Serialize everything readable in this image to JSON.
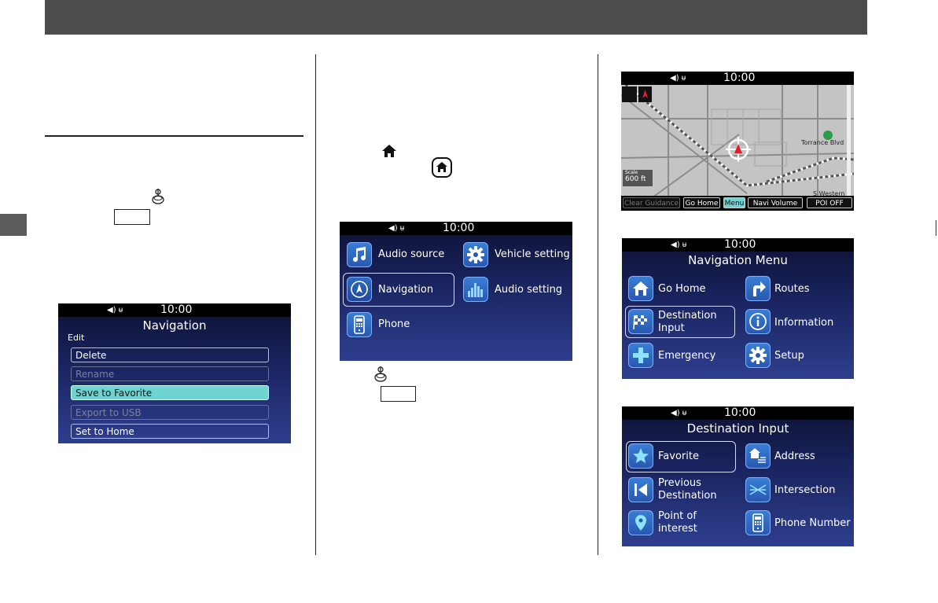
{
  "colors": {
    "header": "#4d4d4d",
    "highlight": "#6fd3d1",
    "screen_top": "#0d1233",
    "screen_bottom": "#2e3f8e"
  },
  "status": {
    "time": "10:00"
  },
  "nav_edit_screen": {
    "title": "Navigation",
    "subtitle": "Edit",
    "items": [
      {
        "label": "Delete",
        "state": "normal"
      },
      {
        "label": "Rename",
        "state": "disabled"
      },
      {
        "label": "Save to Favorite",
        "state": "highlighted"
      },
      {
        "label": "Export to USB",
        "state": "disabled"
      },
      {
        "label": "Set to Home",
        "state": "normal"
      }
    ]
  },
  "home_screen": {
    "items": [
      {
        "label": "Audio source",
        "icon": "music-note-icon"
      },
      {
        "label": "Vehicle setting",
        "icon": "gear-icon"
      },
      {
        "label": "Navigation",
        "icon": "compass-icon"
      },
      {
        "label": "Audio setting",
        "icon": "equalizer-icon"
      },
      {
        "label": "Phone",
        "icon": "phone-icon"
      }
    ]
  },
  "map_screen": {
    "street_label": "Torrance Blvd",
    "street_label2": "S Western Ave",
    "scale_label": "Scale",
    "scale_value": "600 ft",
    "buttons": [
      "Clear Guidance",
      "Go Home",
      "Menu",
      "Navi Volume",
      "POI OFF"
    ]
  },
  "nav_menu_screen": {
    "title": "Navigation Menu",
    "items": [
      {
        "label": "Go Home",
        "icon": "home-icon"
      },
      {
        "label": "Routes",
        "icon": "route-arrow-icon"
      },
      {
        "label": "Destination\nInput",
        "line1": "Destination",
        "line2": "Input",
        "icon": "checkered-flag-icon"
      },
      {
        "label": "Information",
        "icon": "info-icon"
      },
      {
        "label": "Emergency",
        "icon": "cross-icon"
      },
      {
        "label": "Setup",
        "icon": "gear-icon"
      }
    ]
  },
  "dest_input_screen": {
    "title": "Destination Input",
    "items": [
      {
        "line1": "Favorite",
        "icon": "star-icon"
      },
      {
        "line1": "Address",
        "icon": "address-icon"
      },
      {
        "line1": "Previous",
        "line2": "Destination",
        "icon": "previous-icon"
      },
      {
        "line1": "Intersection",
        "icon": "intersection-icon"
      },
      {
        "line1": "Point of",
        "line2": "interest",
        "icon": "location-pin-icon"
      },
      {
        "line1": "Phone Number",
        "icon": "phone-icon"
      }
    ]
  }
}
